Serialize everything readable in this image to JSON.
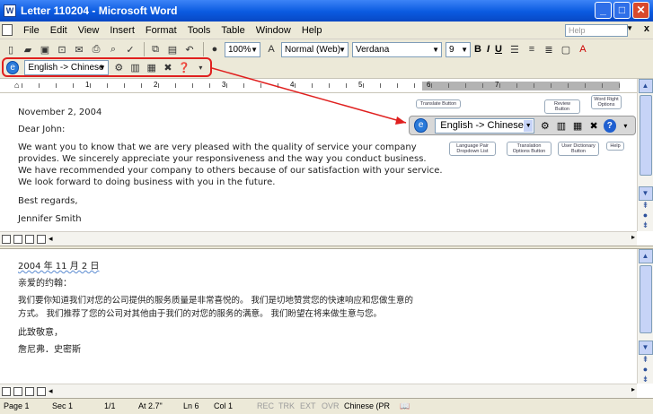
{
  "window": {
    "title": "Letter 110204 - Microsoft Word",
    "app_icon": "W",
    "minimize": "_",
    "maximize": "□",
    "close": "✕"
  },
  "menu": {
    "items": [
      "File",
      "Edit",
      "View",
      "Insert",
      "Format",
      "Tools",
      "Table",
      "Window",
      "Help"
    ],
    "help_placeholder": "Help",
    "close_glyph": "x"
  },
  "toolbar": {
    "zoom": "100%",
    "style": "Normal (Web)",
    "font": "Verdana",
    "size": "9",
    "bold": "B",
    "italic": "I",
    "underline": "U"
  },
  "translation_toolbar": {
    "language": "English -> Chinese"
  },
  "ruler": {
    "numbers": [
      "1",
      "2",
      "3",
      "4",
      "5",
      "6",
      "7"
    ]
  },
  "english_doc": {
    "date": "November 2, 2004",
    "greeting": "Dear John:",
    "paragraph_lines": [
      "We want you to know that we are very pleased with the quality of service your company",
      "provides. We sincerely appreciate your responsiveness and the way you conduct business.",
      "We have recommended your company to others because of our satisfaction with your service.",
      "We look forward to doing business with you in the future."
    ],
    "closing": "Best regards,",
    "signature": "Jennifer Smith"
  },
  "chinese_doc": {
    "date": "2004 年 11 月 2 日",
    "greeting": "亲爱的约翰：",
    "line1": "我们要你知道我们对您的公司提供的服务质量是非常喜悦的。 我们是切地赞赏您的快速响应和您做生意的",
    "line2": "方式。 我们推荐了您的公司对其他由于我们的对您的服务的满意。 我们盼望在将来做生意与您。",
    "closing": "此致敬意，",
    "signature": "詹尼弗．史密斯"
  },
  "callout": {
    "language": "English -> Chinese",
    "labels": {
      "translate": "Translate Button",
      "review": "Review Button",
      "word_right": "Word Right Options",
      "lang_pair": "Language Pair Dropdown List",
      "translation_options": "Translation Options Button",
      "user_dictionary": "User Dictionary Button",
      "help": "Help"
    }
  },
  "status": {
    "page": "Page 1",
    "sec": "Sec 1",
    "pages": "1/1",
    "at": "At 2.7\"",
    "ln": "Ln 6",
    "col": "Col 1",
    "rec": "REC",
    "trk": "TRK",
    "ext": "EXT",
    "ovr": "OVR",
    "lang": "Chinese (PR"
  },
  "colors": {
    "titlebar": "#0a5ae0",
    "highlight": "#e0201f",
    "chrome": "#ece9d8"
  }
}
